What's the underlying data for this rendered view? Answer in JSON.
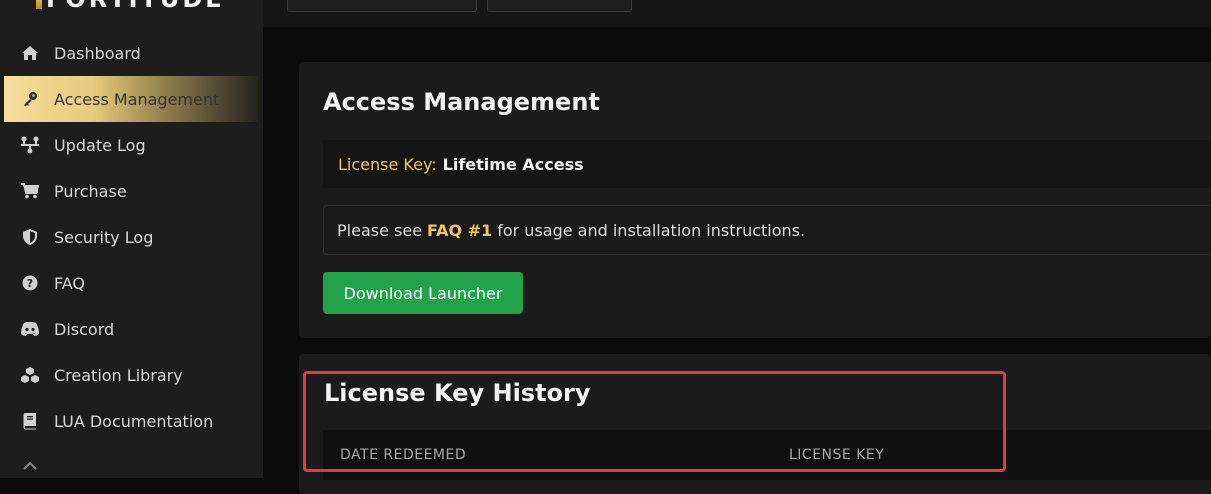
{
  "app": {
    "logo_text": "FORTITUDE"
  },
  "sidebar": {
    "items": [
      {
        "label": "Dashboard",
        "icon": "home-icon"
      },
      {
        "label": "Access Management",
        "icon": "key-icon",
        "active": true
      },
      {
        "label": "Update Log",
        "icon": "update-log-icon"
      },
      {
        "label": "Purchase",
        "icon": "cart-icon"
      },
      {
        "label": "Security Log",
        "icon": "shield-icon"
      },
      {
        "label": "FAQ",
        "icon": "question-icon"
      },
      {
        "label": "Discord",
        "icon": "discord-icon"
      },
      {
        "label": "Creation Library",
        "icon": "cubes-icon"
      },
      {
        "label": "LUA Documentation",
        "icon": "book-icon"
      }
    ]
  },
  "access": {
    "title": "Access Management",
    "license_key_label": "License Key:",
    "license_key_value": "Lifetime Access",
    "info_prefix": "Please see",
    "info_link": "FAQ #1",
    "info_suffix": "for usage and installation instructions.",
    "download_button": "Download Launcher"
  },
  "history": {
    "title": "License Key History",
    "columns": [
      "DATE REDEEMED",
      "LICENSE KEY"
    ]
  },
  "colors": {
    "accent_gold": "#f0c463",
    "download_green": "#22a34a",
    "highlight_red": "#e23c3c"
  }
}
